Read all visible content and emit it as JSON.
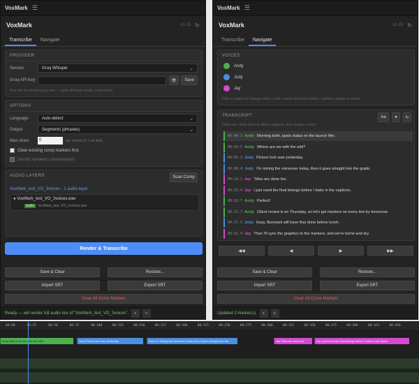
{
  "left": {
    "titlebar": {
      "title": "VoxMark",
      "menu_icon": "hamburger-icon"
    },
    "app": {
      "name": "VoxMark",
      "version": "v1.15",
      "refresh_icon": "refresh-icon"
    },
    "tabs": [
      {
        "label": "Transcribe",
        "active": true
      },
      {
        "label": "Navigate",
        "active": false
      }
    ],
    "provider": {
      "heading": "PROVIDER",
      "service_label": "Service",
      "service_value": "Groq Whisper",
      "apikey_label": "Groq API Key",
      "apikey_value": "",
      "eye_icon": "eye-icon",
      "save_label": "Save",
      "hint": "Free tier at console.groq.com — turbo Whisper model, much faster"
    },
    "options": {
      "heading": "OPTIONS",
      "language_label": "Language",
      "language_value": "Auto-detect",
      "output_label": "Output",
      "output_value": "Segments (phrases)",
      "maxchars_label": "Max chars",
      "maxchars_value": "0",
      "maxchars_hint": "per marker (0 = no limit)",
      "clear_label": "Clear existing comp markers first",
      "identify_label": "Identify speakers (Assemblyai)"
    },
    "audio": {
      "heading": "AUDIO LAYERS",
      "scan_label": "Scan Comp",
      "comp_line": "VoxMark_test_VO_3voices - 1 audio layer",
      "layer_name": "VoxMark_test_VO_3voices.wav",
      "badge": "audio",
      "layer_source": "VoxMark_test_VO_3voices.wav"
    },
    "render_label": "Render & Transcribe",
    "buttons": {
      "save_clear": "Save & Clear",
      "restore": "Restore...",
      "import_srt": "Import SRT",
      "export_srt": "Export SRT",
      "clear_all": "Clear All Comp Markers"
    },
    "status": "Ready — will render full audio mix of \"VoxMark_test_VO_3voices\".",
    "status_icons": [
      "chevron-icon",
      "chevron-icon"
    ]
  },
  "right": {
    "titlebar": {
      "title": "VoxMark",
      "menu_icon": "hamburger-icon"
    },
    "app": {
      "name": "VoxMark",
      "version": "v1.15",
      "refresh_icon": "refresh-icon"
    },
    "tabs": [
      {
        "label": "Transcribe",
        "active": false
      },
      {
        "label": "Navigate",
        "active": true
      }
    ],
    "voices": {
      "heading": "VOICES",
      "items": [
        {
          "name": "Andy",
          "color": "#4caf50"
        },
        {
          "name": "Judy",
          "color": "#4a8fe0"
        },
        {
          "name": "Jay",
          "color": "#d24bd2"
        }
      ],
      "hint": "Click a swatch to change colour • edit a name and press Enter • markers update to match"
    },
    "transcript": {
      "heading": "TRANSCRIPT",
      "hint": "Click row • drag down to attach captions, then assign a voice",
      "font_btn": "Aa",
      "rows": [
        {
          "time": "00:00.3",
          "speaker": "Andy",
          "color": "#4caf50",
          "text": "Morning both, quick status on the launch film."
        },
        {
          "time": "00:03.5",
          "speaker": "Andy",
          "color": "#4caf50",
          "text": "Where are we with the edit?"
        },
        {
          "time": "00:05.3",
          "speaker": "Judy",
          "color": "#4a8fe0",
          "text": "Picture lock was yesterday."
        },
        {
          "time": "00:08.4",
          "speaker": "Judy",
          "color": "#4a8fe0",
          "text": "I'm mixing the voiceover today, then it goes straight into the grade."
        },
        {
          "time": "00:14.1",
          "speaker": "Jay",
          "color": "#d24bd2",
          "text": "Titles are done too."
        },
        {
          "time": "00:15.4",
          "speaker": "Jay",
          "color": "#d24bd2",
          "text": "I just need the final timings before I bake in the captions."
        },
        {
          "time": "00:19.7",
          "speaker": "Andy",
          "color": "#4caf50",
          "text": "Perfect!"
        },
        {
          "time": "00:21.7",
          "speaker": "Andy",
          "color": "#4caf50",
          "text": "Client review is on Thursday, so let's get markers on every line by tomorrow."
        },
        {
          "time": "00:27.5",
          "speaker": "Judy",
          "color": "#4a8fe0",
          "text": "Easy, Boxmark will have that done before lunch."
        },
        {
          "time": "00:31.9",
          "speaker": "Jay",
          "color": "#d24bd2",
          "text": "Then I'll sync the graphics to the markers, and we're home and dry."
        }
      ]
    },
    "nav": [
      "◀◀",
      "◀",
      "▶",
      "▶▶"
    ],
    "buttons": {
      "save_clear": "Save & Clear",
      "restore": "Restore...",
      "import_srt": "Import SRT",
      "export_srt": "Export SRT",
      "clear_all": "Clear All Comp Markers"
    },
    "status": "Updated 2 marker(s).",
    "status_icons": [
      "chevron-icon",
      "chevron-icon"
    ]
  },
  "timeline": {
    "ticks": [
      "00:00",
      "00:25",
      "00:50",
      "00:75",
      "00:100",
      "00:125",
      "00:150",
      "00:175",
      "00:200",
      "00:225",
      "00:250",
      "00:275",
      "00:300",
      "00:325",
      "00:350",
      "00:375",
      "00:400",
      "00:425",
      "00:450"
    ],
    "markers": [
      {
        "text": "Andy Where are we with the edit?",
        "color": "#4caf50"
      },
      {
        "text": "Judy Picture lock was yesterday",
        "color": "#4a8fe0"
      },
      {
        "text": "Judy I'm mixing the voiceover today, then it goes straight into the",
        "color": "#4a8fe0"
      },
      {
        "text": "Jay Titles are done too",
        "color": "#d24bd2"
      },
      {
        "text": "Jay I just need the final timings before I bake in the captio",
        "color": "#d24bd2"
      }
    ]
  }
}
